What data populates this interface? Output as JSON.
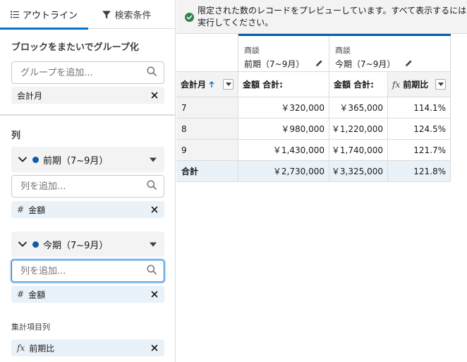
{
  "tabs": {
    "outline": "アウトライン",
    "filters": "検索条件"
  },
  "group_rows": {
    "title": "ブロックをまたいでグループ化",
    "search_placeholder": "グループを追加...",
    "items": [
      "会計月"
    ]
  },
  "columns": {
    "title": "列",
    "blocks": [
      {
        "name": "前期（7~9月）",
        "search_placeholder": "列を追加...",
        "items": [
          "金額"
        ]
      },
      {
        "name": "今期（7~9月）",
        "search_placeholder": "列を追加...",
        "items": [
          "金額"
        ]
      }
    ],
    "summary_title": "集計項目列",
    "summary_items": [
      "前期比"
    ]
  },
  "icons": {
    "outline_tab": "list-icon",
    "filter_tab": "funnel-icon",
    "search": "search-icon",
    "remove": "close-icon",
    "collapse": "chevron-down-icon",
    "block_menu": "caret-down-icon",
    "edit": "pencil-icon",
    "sort": "arrow-up-icon",
    "formula": "fx-icon",
    "number": "hash-icon",
    "notice": "check-circle-icon"
  },
  "colors": {
    "accent": "#0176d3",
    "block_marker": "#0b5cab",
    "notice_green": "#2e844a"
  },
  "banner": {
    "line1": "限定された数のレコードをプレビューしています。すべて表示するには",
    "line2": "実行してください。"
  },
  "table": {
    "blocks": [
      {
        "object": "商談",
        "name": "前期（7~9月）"
      },
      {
        "object": "商談",
        "name": "今期（7~9月）"
      }
    ],
    "headers": {
      "group": "会計月",
      "block1_sum": "金額 合計:",
      "block2_sum": "金額 合計:",
      "formula": "前期比"
    },
    "rows": [
      {
        "month": "7",
        "prev": "￥320,000",
        "curr": "￥365,000",
        "ratio": "114.1%"
      },
      {
        "month": "8",
        "prev": "￥980,000",
        "curr": "￥1,220,000",
        "ratio": "124.5%"
      },
      {
        "month": "9",
        "prev": "￥1,430,000",
        "curr": "￥1,740,000",
        "ratio": "121.7%"
      }
    ],
    "total": {
      "label": "合計",
      "prev": "￥2,730,000",
      "curr": "￥3,325,000",
      "ratio": "121.8%"
    }
  }
}
